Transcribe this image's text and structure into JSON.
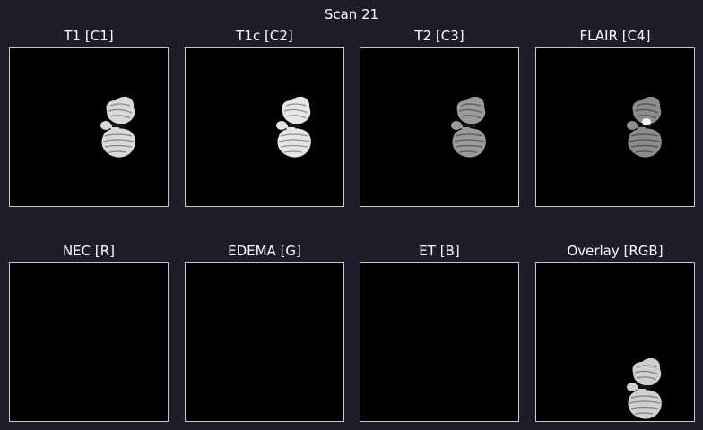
{
  "figure": {
    "title": "Scan 21"
  },
  "panels": [
    {
      "id": "t1",
      "title": "T1 [C1]",
      "kind": "brain",
      "fill": "#d9d9d9",
      "stripe": "#6f6f6f",
      "highlight": false
    },
    {
      "id": "t1c",
      "title": "T1c [C2]",
      "kind": "brain",
      "fill": "#e6e6e6",
      "stripe": "#7a7a7a",
      "highlight": false
    },
    {
      "id": "t2",
      "title": "T2 [C3]",
      "kind": "brain",
      "fill": "#9a9a9a",
      "stripe": "#4a4a4a",
      "highlight": false
    },
    {
      "id": "flair",
      "title": "FLAIR [C4]",
      "kind": "brain",
      "fill": "#8c8c8c",
      "stripe": "#3e3e3e",
      "highlight": true
    },
    {
      "id": "nec",
      "title": "NEC [R]",
      "kind": "empty",
      "fill": "#000000",
      "stripe": "#000000",
      "highlight": false
    },
    {
      "id": "edema",
      "title": "EDEMA [G]",
      "kind": "empty",
      "fill": "#000000",
      "stripe": "#000000",
      "highlight": false
    },
    {
      "id": "et",
      "title": "ET [B]",
      "kind": "empty",
      "fill": "#000000",
      "stripe": "#000000",
      "highlight": false
    },
    {
      "id": "overlay",
      "title": "Overlay [RGB]",
      "kind": "brain",
      "fill": "#cfcfcf",
      "stripe": "#6a6a6a",
      "highlight": false
    }
  ],
  "colors": {
    "background": "#1d1e2a",
    "frame_border": "#c8c8c8",
    "image_background": "#000000",
    "text": "#ffffff"
  }
}
